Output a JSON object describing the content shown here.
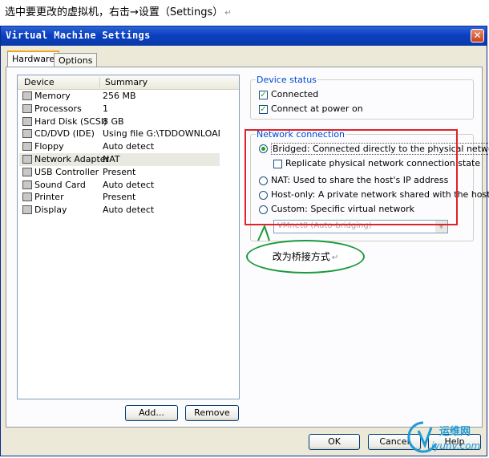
{
  "caption": "选中要更改的虚拟机，右击→设置（Settings）",
  "window": {
    "title": "Virtual Machine Settings",
    "close_symbol": "✕"
  },
  "tabs": [
    {
      "label": "Hardware"
    },
    {
      "label": "Options"
    }
  ],
  "device_list": {
    "columns": [
      "Device",
      "Summary"
    ],
    "rows": [
      {
        "icon": "memory-icon",
        "device": "Memory",
        "summary": "256 MB"
      },
      {
        "icon": "processor-icon",
        "device": "Processors",
        "summary": "1"
      },
      {
        "icon": "hard-disk-icon",
        "device": "Hard Disk (SCSI)",
        "summary": "8 GB"
      },
      {
        "icon": "cd-dvd-icon",
        "device": "CD/DVD (IDE)",
        "summary": "Using file G:\\TDDOWNLOAD\\..."
      },
      {
        "icon": "floppy-icon",
        "device": "Floppy",
        "summary": "Auto detect"
      },
      {
        "icon": "network-adapter-icon",
        "device": "Network Adapter",
        "summary": "NAT"
      },
      {
        "icon": "usb-icon",
        "device": "USB Controller",
        "summary": "Present"
      },
      {
        "icon": "sound-card-icon",
        "device": "Sound Card",
        "summary": "Auto detect"
      },
      {
        "icon": "printer-icon",
        "device": "Printer",
        "summary": "Present"
      },
      {
        "icon": "display-icon",
        "device": "Display",
        "summary": "Auto detect"
      }
    ],
    "selected_index": 5
  },
  "device_status": {
    "legend": "Device status",
    "connected": {
      "label": "Connected",
      "checked": true
    },
    "connect_at_power_on": {
      "label": "Connect at power on",
      "checked": true
    }
  },
  "network_connection": {
    "legend": "Network connection",
    "bridged": {
      "label": "Bridged: Connected directly to the physical network",
      "selected": true
    },
    "replicate": {
      "label": "Replicate physical network connection state",
      "checked": false
    },
    "nat": {
      "label": "NAT: Used to share the host's IP address",
      "selected": false
    },
    "host_only": {
      "label": "Host-only: A private network shared with the host",
      "selected": false
    },
    "custom": {
      "label": "Custom: Specific virtual network",
      "selected": false
    },
    "custom_select_value": "VMnet0 (Auto-bridging)"
  },
  "annotation": {
    "bubble_text": "改为桥接方式",
    "highlight_color": "#e0222b",
    "bubble_color": "#1a9a3a"
  },
  "buttons": {
    "add": "Add...",
    "remove": "Remove",
    "ok": "OK",
    "cancel": "Cancel",
    "help": "Help"
  },
  "watermark": {
    "line1": "运维网",
    "line2": "iyunv.com"
  }
}
